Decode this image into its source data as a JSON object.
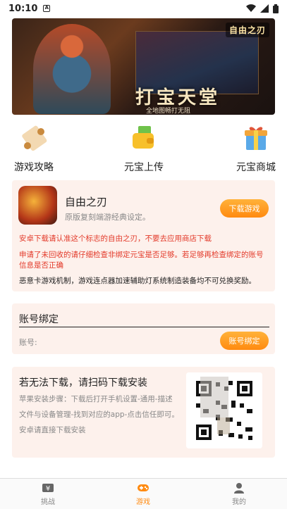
{
  "status_bar": {
    "time": "10:10",
    "sim_icon": "A"
  },
  "banner": {
    "logo_text": "自由之刃",
    "headline": "打宝天堂",
    "subline": "全地图畅打无阻"
  },
  "shortcuts": [
    {
      "label": "游戏攻略",
      "icon": "scroll-icon"
    },
    {
      "label": "元宝上传",
      "icon": "wallet-icon"
    },
    {
      "label": "元宝商城",
      "icon": "gift-icon"
    }
  ],
  "game_card": {
    "name": "自由之刃",
    "desc": "原版复刻端游经典设定。",
    "download_label": "下载游戏",
    "warning_1": "安卓下载请认准这个标志的自由之刃，不要去应用商店下载",
    "warning_2": "申请了未回收的请仔细检查非绑定元宝是否足够。若足够再检查绑定的账号信息是否正确",
    "notice": "恶意卡游戏机制，游戏连点器加速辅助灯系统制造装备均不可兑换奖励。"
  },
  "bind_card": {
    "title": "账号绑定",
    "account_label": "账号:",
    "bind_label": "账号绑定"
  },
  "qr_card": {
    "title": "若无法下载，请扫码下载安装",
    "steps": "苹果安装步骤：下载后打开手机设置-通用-描述文件与设备管理-找到对应的app-点击信任即可。安卓请直接下载安装"
  },
  "tabbar": {
    "tabs": [
      {
        "label": "挑战",
        "icon": "ticket-icon",
        "active": false
      },
      {
        "label": "游戏",
        "icon": "gamepad-icon",
        "active": true
      },
      {
        "label": "我的",
        "icon": "user-icon",
        "active": false
      }
    ],
    "active_color": "#ff8a10",
    "inactive_color": "#888888"
  },
  "colors": {
    "accent": "#ff8a10",
    "warning": "#e33a2a",
    "card_bg": "#fdf1ec"
  }
}
